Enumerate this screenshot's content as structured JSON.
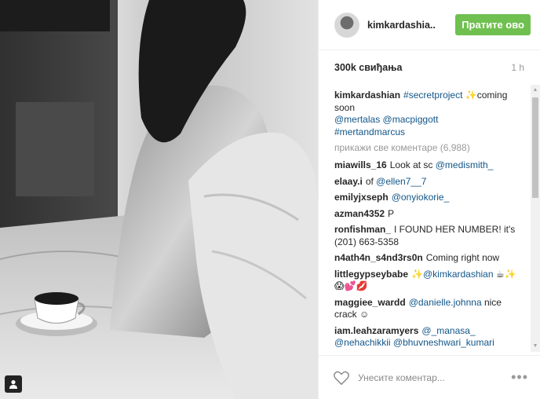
{
  "post": {
    "photo_alt": "Black and white photo on a bed with a coffee cup",
    "user_tag_icon": "person-icon"
  },
  "header": {
    "username": "kimkardashia..",
    "follow_label": "Пратите ово"
  },
  "stats": {
    "likes": "300k свиђања",
    "time": "1 h"
  },
  "caption": {
    "author": "kimkardashian",
    "text_link": "#secretproject",
    "text_tail": " ✨coming soon",
    "mentions": "@mertalas @macpiggott",
    "hashtag": "#mertandmarcus"
  },
  "load_more": "прикажи све коментаре (6,988)",
  "comments": [
    {
      "author": "miawills_16",
      "text": "Look at sc ",
      "link": "@medismith_",
      "tail": ""
    },
    {
      "author": "elaay.i",
      "text": "of ",
      "link": "@ellen7__7",
      "tail": ""
    },
    {
      "author": "emilyjxseph",
      "text": "",
      "link": "@onyiokorie_",
      "tail": ""
    },
    {
      "author": "azman4352",
      "text": "P",
      "link": "",
      "tail": ""
    },
    {
      "author": "ronfishman_",
      "text": "I FOUND HER NUMBER! it's (201) 663-5358",
      "link": "",
      "tail": ""
    },
    {
      "author": "n4ath4n_s4nd3rs0n",
      "text": "Coming right now",
      "link": "",
      "tail": ""
    },
    {
      "author": "littlegypseybabe",
      "text": "✨",
      "link": "@kimkardashian",
      "tail": " ☕✨😱💕💋"
    },
    {
      "author": "maggiee_wardd",
      "text": "",
      "link": "@danielle.johnna",
      "tail": " nice crack ☺"
    },
    {
      "author": "iam.leahzaramyers",
      "text": "",
      "link": "@_manasa_ @nehachikkii @bhuvneshwari_kumari",
      "tail": ""
    }
  ],
  "footer": {
    "comment_placeholder": "Унесите коментар...",
    "more_label": "•••"
  },
  "colors": {
    "follow_button": "#70c050",
    "link": "#125688",
    "muted": "#999999"
  }
}
